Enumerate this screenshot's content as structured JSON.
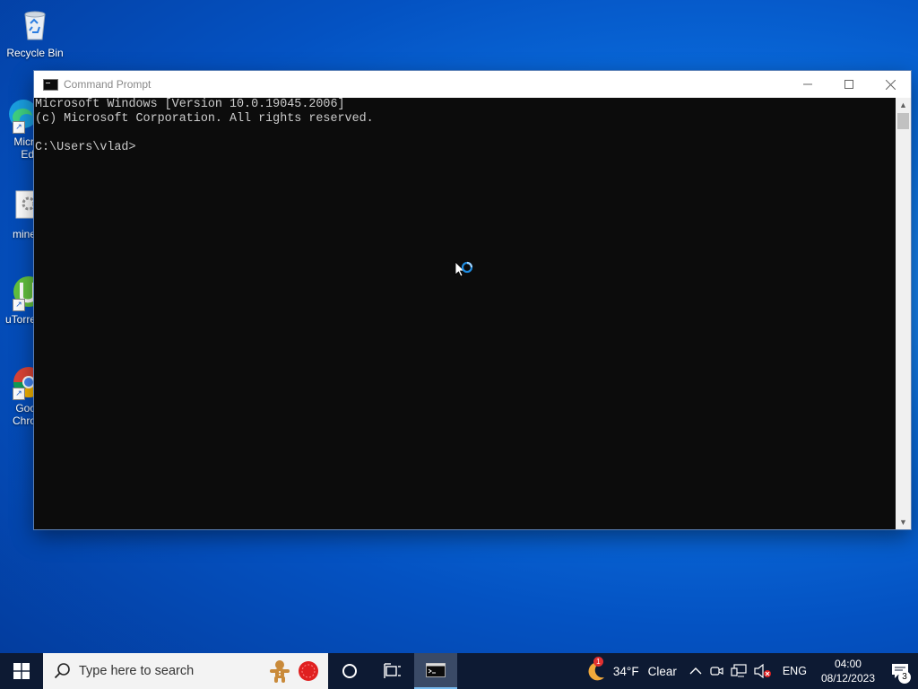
{
  "desktop": {
    "icons": [
      {
        "label": "Recycle Bin",
        "icon": "recycle-bin-icon"
      },
      {
        "label": "Micr\nEd",
        "icon": "edge-icon"
      },
      {
        "label": "mine",
        "icon": "app-icon"
      },
      {
        "label": "uTorre",
        "icon": "utorrent-icon"
      },
      {
        "label": "Goo\nChro",
        "icon": "chrome-icon"
      }
    ]
  },
  "window": {
    "title": "Command Prompt",
    "console_lines": [
      "Microsoft Windows [Version 10.0.19045.2006]",
      "(c) Microsoft Corporation. All rights reserved.",
      "",
      "C:\\Users\\vlad>"
    ]
  },
  "taskbar": {
    "search_placeholder": "Type here to search",
    "weather": {
      "temp": "34°F",
      "condition": "Clear",
      "alert_count": "1"
    },
    "language": "ENG",
    "time": "04:00",
    "date": "08/12/2023",
    "notification_count": "3"
  },
  "colors": {
    "taskbar_bg": "#0d1a33",
    "console_bg": "#0c0c0c",
    "console_fg": "#cccccc",
    "desktop_accent": "#0a6fe0"
  }
}
